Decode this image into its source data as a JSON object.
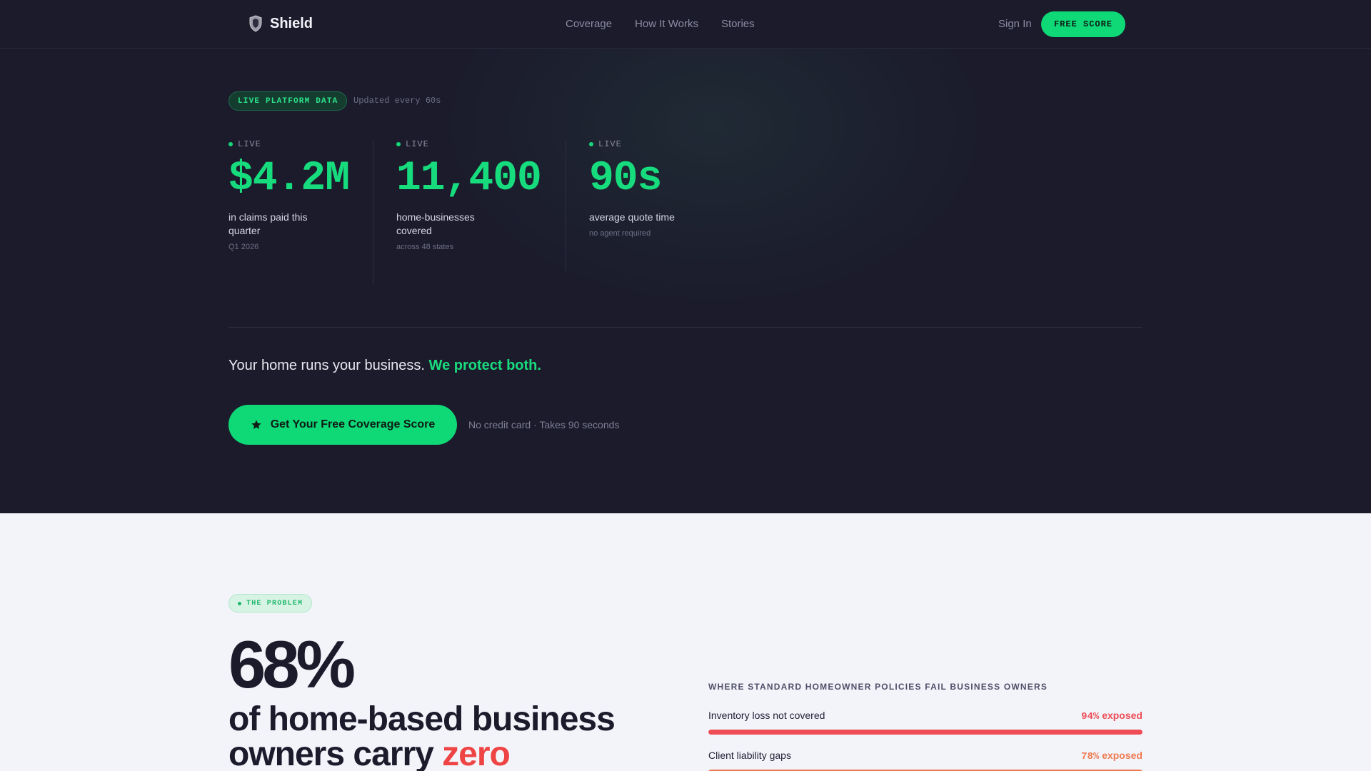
{
  "nav": {
    "brand": "Shield",
    "links": [
      "Coverage",
      "How It Works",
      "Stories"
    ],
    "sign_in": "Sign In",
    "free_score": "FREE SCORE"
  },
  "hero": {
    "badge": "LIVE PLATFORM DATA",
    "updated": "Updated every 60s",
    "stats": [
      {
        "live": "LIVE",
        "value": "$4.2M",
        "label_lines": [
          "in claims paid this",
          "quarter"
        ],
        "sub": "Q1 2026"
      },
      {
        "live": "LIVE",
        "value": "11,400",
        "label_lines": [
          "home-businesses",
          "covered"
        ],
        "sub": "across 48 states"
      },
      {
        "live": "LIVE",
        "value": "90s",
        "label_lines": [
          "average quote time"
        ],
        "sub": "no agent required"
      }
    ],
    "tagline": "Your home runs your business.",
    "tagline_accent": "We protect both.",
    "cta": "Get Your Free Coverage Score",
    "cta_note": "No credit card · Takes 90 seconds"
  },
  "problem": {
    "badge": "THE PROBLEM",
    "big_pct": "68%",
    "headline_line1": "of home-based business",
    "headline_line2": "owners carry",
    "headline_accent": "zero",
    "fail_title": "WHERE STANDARD HOMEOWNER POLICIES FAIL BUSINESS OWNERS",
    "bars": [
      {
        "label": "Inventory loss not covered",
        "pct_text": "94%",
        "suffix": "exposed",
        "value": 94,
        "color": "#ee4d55"
      },
      {
        "label": "Client liability gaps",
        "pct_text": "78%",
        "suffix": "exposed",
        "value": 78,
        "color": "#ef7a4f"
      }
    ]
  },
  "colors": {
    "accent": "#17dc7d",
    "bg_dark": "#1b1b2c",
    "danger": "#ee4444"
  }
}
